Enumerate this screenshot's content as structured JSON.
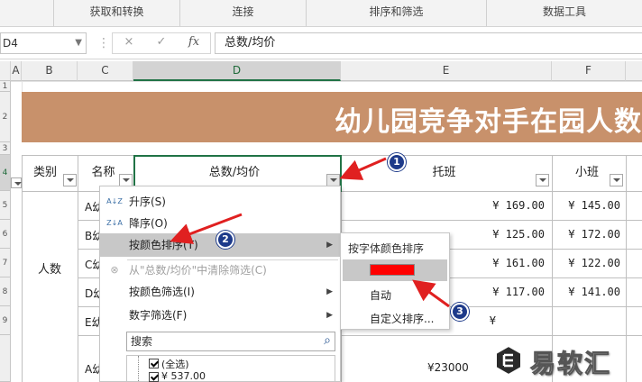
{
  "ribbon": {
    "groups": [
      "获取和转换",
      "连接",
      "排序和筛选",
      "数据工具"
    ]
  },
  "formula_bar": {
    "name_box": "D4",
    "cancel_icon": "×",
    "enter_icon": "✓",
    "fx_icon": "fx",
    "formula": "总数/均价"
  },
  "column_headers": [
    "A",
    "B",
    "C",
    "D",
    "E",
    "F"
  ],
  "row_headers": [
    "1",
    "2",
    "3",
    "4",
    "5",
    "6",
    "7",
    "8",
    "9"
  ],
  "sheet": {
    "banner_title": "幼儿园竞争对手在园人数",
    "banner_color": "#c8916b",
    "headers": {
      "b": "类别",
      "c": "名称",
      "d": "总数/均价",
      "e": "托班",
      "f": "小班"
    },
    "category": "人数",
    "names": [
      "A幼",
      "B幼",
      "C幼",
      "D幼",
      "E幼",
      "A幼"
    ],
    "e_values": [
      "¥ 169.00",
      "¥ 125.00",
      "¥ 161.00",
      "¥ 117.00",
      "¥",
      "¥23000"
    ],
    "f_values": [
      "¥ 145.00",
      "¥ 172.00",
      "¥ 122.00",
      "¥ 141.00"
    ]
  },
  "filter_menu": {
    "items": [
      {
        "label": "升序(S)",
        "icon": "A↓Z"
      },
      {
        "label": "降序(O)",
        "icon": "Z↓A"
      },
      {
        "label": "按颜色排序(T)",
        "icon": ""
      },
      {
        "label": "从\"总数/均价\"中清除筛选(C)",
        "icon": "⊗"
      },
      {
        "label": "按颜色筛选(I)",
        "icon": ""
      },
      {
        "label": "数字筛选(F)",
        "icon": ""
      }
    ],
    "search_placeholder": "搜索",
    "search_icon": "⌕",
    "checkbox_items": [
      "(全选)",
      "¥ 537.00"
    ]
  },
  "color_submenu": {
    "title": "按字体颜色排序",
    "swatch_color": "#ff0000",
    "items": [
      "自动",
      "自定义排序..."
    ]
  },
  "badges": [
    "1",
    "2",
    "3"
  ],
  "watermark": {
    "text": "易软汇"
  }
}
